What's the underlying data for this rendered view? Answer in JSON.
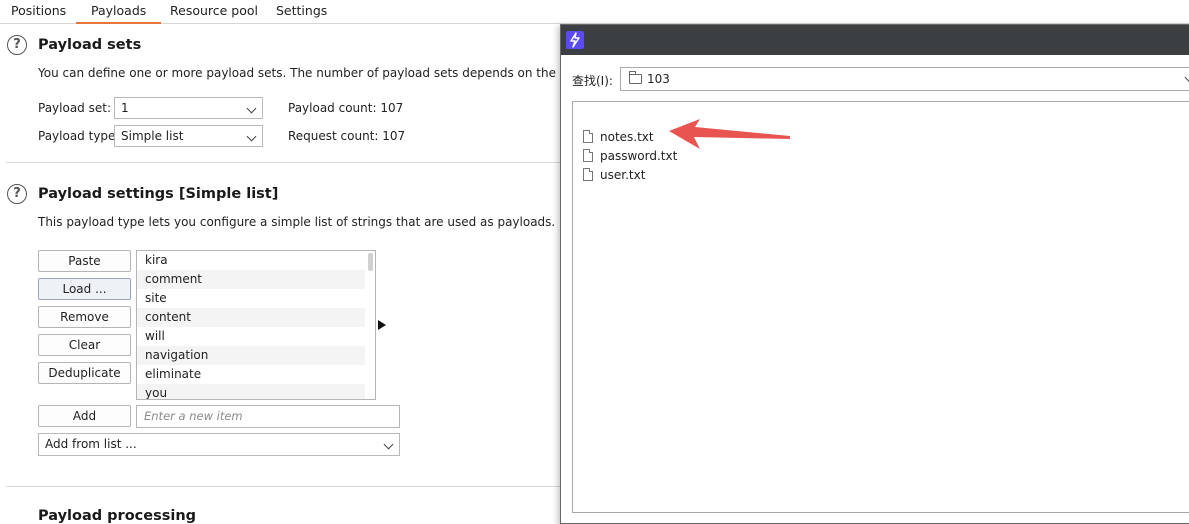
{
  "tabs": [
    {
      "label": "Positions"
    },
    {
      "label": "Payloads"
    },
    {
      "label": "Resource pool"
    },
    {
      "label": "Settings"
    }
  ],
  "payload_sets": {
    "title": "Payload sets",
    "description": "You can define one or more payload sets. The number of payload sets depends on the attack type defin",
    "set_label": "Payload set:",
    "set_value": "1",
    "type_label": "Payload type:",
    "type_value": "Simple list",
    "payload_count": "Payload count:  107",
    "request_count": "Request count:  107"
  },
  "payload_settings": {
    "title": "Payload settings [Simple list]",
    "description": "This payload type lets you configure a simple list of strings that are used as payloads.",
    "buttons": {
      "paste": "Paste",
      "load": "Load ...",
      "remove": "Remove",
      "clear": "Clear",
      "deduplicate": "Deduplicate",
      "add": "Add"
    },
    "items": [
      "kira",
      "comment",
      "site",
      "content",
      "will",
      "navigation",
      "eliminate",
      "you"
    ],
    "new_item_placeholder": "Enter a new item",
    "add_from_list": "Add from list ..."
  },
  "payload_processing": {
    "title": "Payload processing"
  },
  "file_dialog": {
    "look_in_label": "查找(I):",
    "directory": "103",
    "files": [
      "notes.txt",
      "password.txt",
      "user.txt"
    ]
  },
  "colors": {
    "accent_tab": "#e8753a",
    "annotation_arrow": "#e85450",
    "dialog_titlebar": "#3c3f41",
    "logo": "#5b4bf0"
  },
  "icons": [
    "help-icon",
    "chevron-down-icon",
    "folder-icon",
    "file-icon",
    "app-logo-icon",
    "play-icon",
    "annotation-arrow"
  ]
}
